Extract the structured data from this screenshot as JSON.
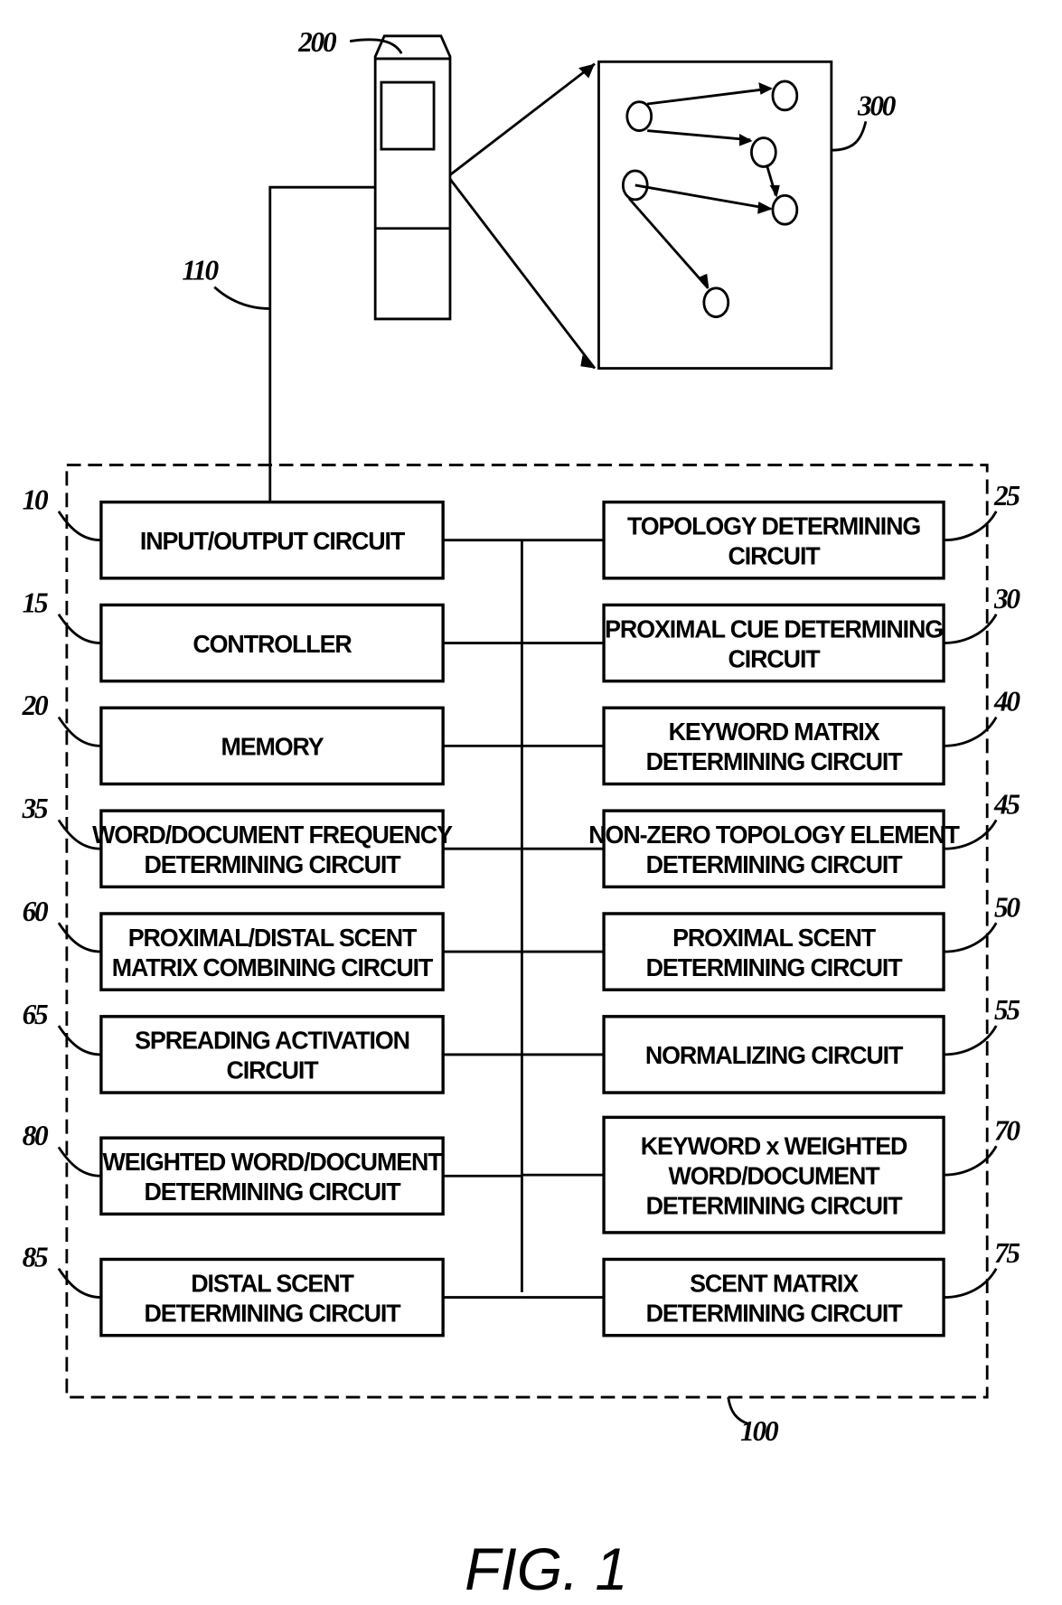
{
  "figure_caption": "FIG. 1",
  "references": {
    "device": "200",
    "display": "300",
    "link": "110",
    "system": "100"
  },
  "left_blocks": [
    {
      "ref": "10",
      "lines": [
        "INPUT/OUTPUT CIRCUIT"
      ]
    },
    {
      "ref": "15",
      "lines": [
        "CONTROLLER"
      ]
    },
    {
      "ref": "20",
      "lines": [
        "MEMORY"
      ]
    },
    {
      "ref": "35",
      "lines": [
        "WORD/DOCUMENT FREQUENCY",
        "DETERMINING CIRCUIT"
      ]
    },
    {
      "ref": "60",
      "lines": [
        "PROXIMAL/DISTAL SCENT",
        "MATRIX COMBINING CIRCUIT"
      ]
    },
    {
      "ref": "65",
      "lines": [
        "SPREADING ACTIVATION",
        "CIRCUIT"
      ]
    },
    {
      "ref": "80",
      "lines": [
        "WEIGHTED WORD/DOCUMENT",
        "DETERMINING CIRCUIT"
      ]
    },
    {
      "ref": "85",
      "lines": [
        "DISTAL SCENT",
        "DETERMINING CIRCUIT"
      ]
    }
  ],
  "right_blocks": [
    {
      "ref": "25",
      "lines": [
        "TOPOLOGY DETERMINING",
        "CIRCUIT"
      ]
    },
    {
      "ref": "30",
      "lines": [
        "PROXIMAL CUE DETERMINING",
        "CIRCUIT"
      ]
    },
    {
      "ref": "40",
      "lines": [
        "KEYWORD MATRIX",
        "DETERMINING CIRCUIT"
      ]
    },
    {
      "ref": "45",
      "lines": [
        "NON-ZERO TOPOLOGY ELEMENT",
        "DETERMINING CIRCUIT"
      ]
    },
    {
      "ref": "50",
      "lines": [
        "PROXIMAL SCENT",
        "DETERMINING CIRCUIT"
      ]
    },
    {
      "ref": "55",
      "lines": [
        "NORMALIZING CIRCUIT"
      ]
    },
    {
      "ref": "70",
      "lines": [
        "KEYWORD x WEIGHTED",
        "WORD/DOCUMENT",
        "DETERMINING CIRCUIT"
      ]
    },
    {
      "ref": "75",
      "lines": [
        "SCENT MATRIX",
        "DETERMINING CIRCUIT"
      ]
    }
  ]
}
